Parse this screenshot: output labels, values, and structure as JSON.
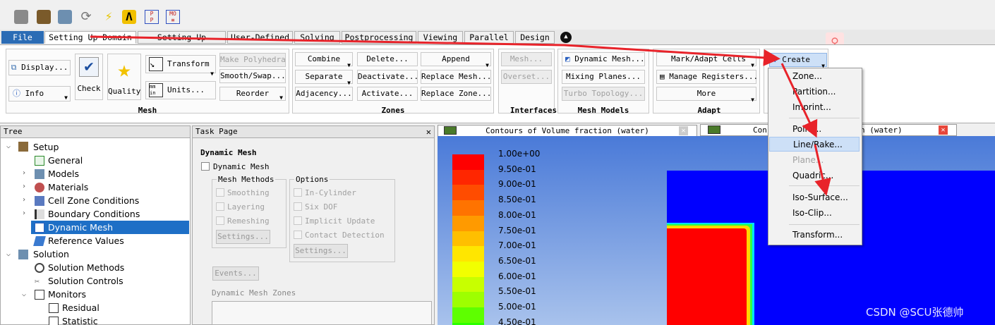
{
  "ribbon_tabs": [
    "File",
    "Setting Up Domain",
    "Setting Up Physics",
    "User-Defined",
    "Solving",
    "Postprocessing",
    "Viewing",
    "Parallel",
    "Design"
  ],
  "mesh_group": {
    "title": "Mesh",
    "display": "Display...",
    "info": "Info",
    "check": "Check",
    "quality": "Quality",
    "transform": "Transform",
    "units": "Units...",
    "make_polyhedra": "Make Polyhedra",
    "smooth_swap": "Smooth/Swap...",
    "reorder": "Reorder"
  },
  "zones_group": {
    "title": "Zones",
    "combine": "Combine",
    "delete": "Delete...",
    "append": "Append",
    "separate": "Separate",
    "deactivate": "Deactivate...",
    "replace_mesh": "Replace Mesh...",
    "adjacency": "Adjacency...",
    "activate": "Activate...",
    "replace_zone": "Replace Zone..."
  },
  "interfaces_group": {
    "title": "Interfaces",
    "mesh": "Mesh...",
    "overset": "Overset..."
  },
  "mesh_models_group": {
    "title": "Mesh Models",
    "dynamic_mesh": "Dynamic Mesh...",
    "mixing_planes": "Mixing Planes...",
    "turbo_topology": "Turbo Topology..."
  },
  "adapt_group": {
    "title": "Adapt",
    "mark_adapt": "Mark/Adapt Cells",
    "manage_registers": "Manage Registers...",
    "more": "More"
  },
  "surface_group": {
    "create": "Create"
  },
  "tree": {
    "header": "Tree",
    "items": [
      "Setup",
      "General",
      "Models",
      "Materials",
      "Cell Zone Conditions",
      "Boundary Conditions",
      "Dynamic Mesh",
      "Reference Values",
      "Solution",
      "Solution Methods",
      "Solution Controls",
      "Monitors",
      "Residual",
      "Statistic"
    ]
  },
  "task_page": {
    "header": "Task Page",
    "title": "Dynamic Mesh",
    "dynamic_mesh_checkbox": "Dynamic Mesh",
    "mesh_methods_label": "Mesh Methods",
    "smoothing": "Smoothing",
    "layering": "Layering",
    "remeshing": "Remeshing",
    "settings1": "Settings...",
    "options_label": "Options",
    "in_cylinder": "In-Cylinder",
    "six_dof": "Six DOF",
    "implicit_update": "Implicit Update",
    "contact_detection": "Contact Detection",
    "settings2": "Settings...",
    "events": "Events...",
    "zones_label": "Dynamic Mesh Zones"
  },
  "graphics": {
    "tab1": "Contours of Volume fraction (water)",
    "tab2_left": "Con",
    "tab2_right": "n (water)",
    "colorbar_labels": [
      "1.00e+00",
      "9.50e-01",
      "9.00e-01",
      "8.50e-01",
      "8.00e-01",
      "7.50e-01",
      "7.00e-01",
      "6.50e-01",
      "6.00e-01",
      "5.50e-01",
      "5.00e-01",
      "4.50e-01"
    ],
    "colorbar_colors": [
      "#ff0000",
      "#ff2600",
      "#ff4c00",
      "#ff7300",
      "#ff9a00",
      "#ffbf00",
      "#ffe600",
      "#f2ff00",
      "#c8ff00",
      "#9eff00",
      "#5eff00",
      "#2cff00"
    ]
  },
  "create_menu": {
    "items": [
      "Zone...",
      "Partition...",
      "Imprint...",
      "Point...",
      "Line/Rake...",
      "Plane...",
      "Quadric...",
      "Iso-Surface...",
      "Iso-Clip...",
      "Transform..."
    ]
  },
  "watermark": "CSDN @SCU张德帅",
  "colors": {
    "file_tab": "#2b6cb5",
    "selection": "#1e6fc6",
    "arrow": "#e8232a"
  }
}
